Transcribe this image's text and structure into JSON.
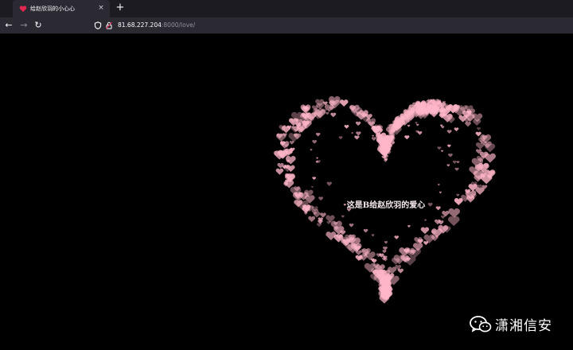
{
  "browser": {
    "tab": {
      "title": "给赵欣羽的小心心",
      "close_glyph": "×",
      "favicon": "red-heart-icon"
    },
    "new_tab_glyph": "+",
    "nav": {
      "back_glyph": "←",
      "forward_glyph": "→",
      "reload_glyph": "↻"
    },
    "url": {
      "host": "81.68.227.204",
      "path": ":8000/love/"
    }
  },
  "page": {
    "message": "这是B给赵欣羽的爱心",
    "heart_color": "#ffb6c8",
    "background": "#000000"
  },
  "watermark": {
    "text": "潇湘信安",
    "icon": "wechat-icon"
  },
  "colors": {
    "tab_bar": "#1c1b22",
    "toolbar": "#2b2a33",
    "heart": "#ffb6c8",
    "favicon": "#e22850"
  }
}
